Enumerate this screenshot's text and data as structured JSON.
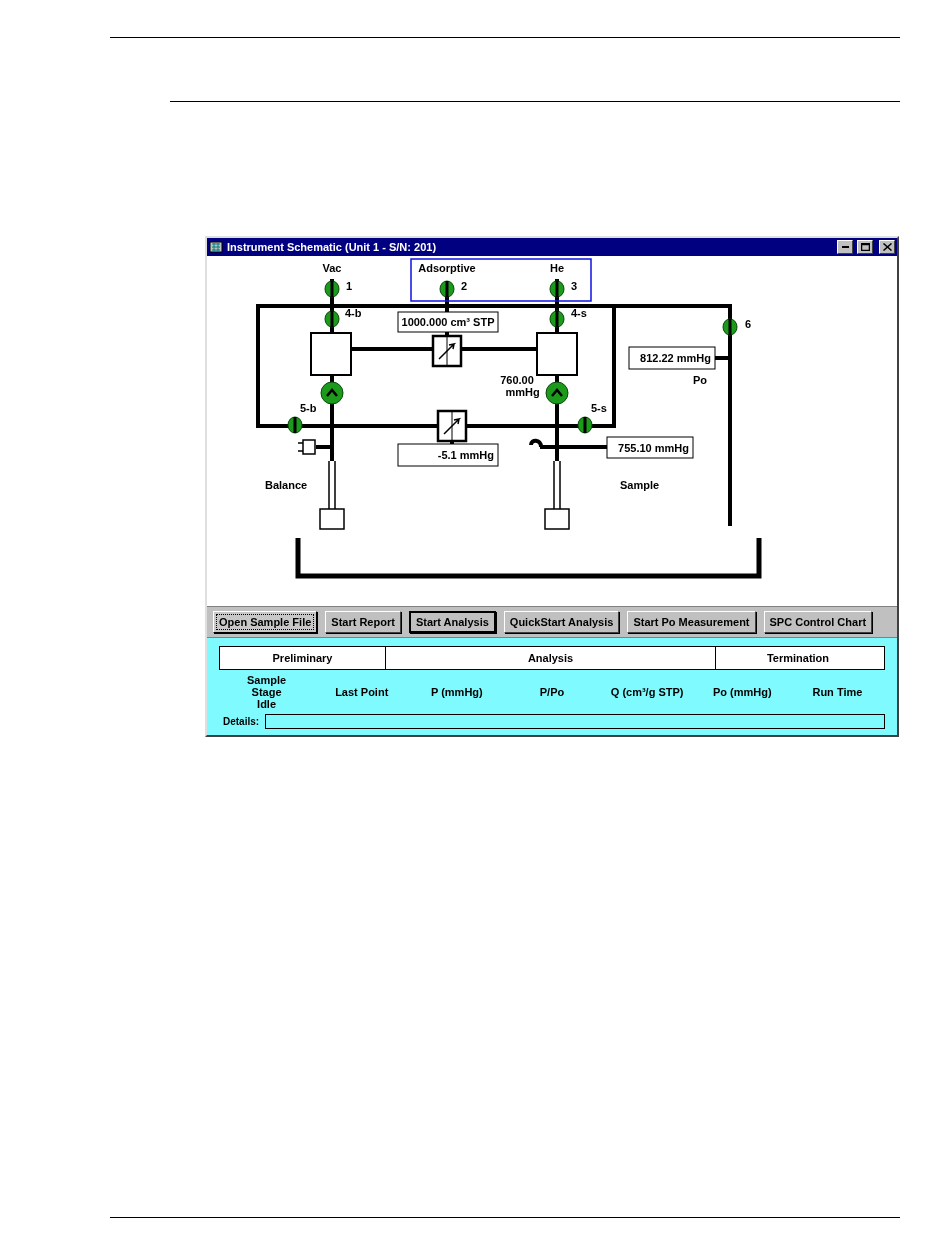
{
  "window": {
    "title": "Instrument Schematic (Unit 1 - S/N: 201)"
  },
  "schematic": {
    "gas_inlets": [
      {
        "label": "Vac",
        "port": "1",
        "open": true,
        "selected": false
      },
      {
        "label": "Adsorptive",
        "port": "2",
        "open": true,
        "selected": true
      },
      {
        "label": "He",
        "port": "3",
        "open": true,
        "selected": true
      }
    ],
    "valves": [
      {
        "label": "4-b",
        "open": true
      },
      {
        "label": "4-s",
        "open": true
      },
      {
        "label": "5-b",
        "open": true
      },
      {
        "label": "5-s",
        "open": true
      },
      {
        "label": "6",
        "open": true
      }
    ],
    "pumps": [
      {
        "open": true
      },
      {
        "open": true
      }
    ],
    "readouts": [
      {
        "kind": "volume",
        "value": "1000.000 cm³ STP"
      },
      {
        "kind": "pressure",
        "value": "-5.1 mmHg"
      },
      {
        "kind": "pressure",
        "value": "755.10 mmHg"
      },
      {
        "kind": "pressure",
        "value": "812.22 mmHg"
      }
    ],
    "labels": [
      {
        "kind": "reading",
        "text": "760.00 mmHg"
      },
      {
        "kind": "name",
        "text": "Po"
      },
      {
        "kind": "name",
        "text": "Balance"
      },
      {
        "kind": "name",
        "text": "Sample"
      }
    ]
  },
  "buttons": [
    {
      "label": "Open Sample File",
      "focused": true,
      "default": false
    },
    {
      "label": "Start Report",
      "focused": false,
      "default": false
    },
    {
      "label": "Start Analysis",
      "focused": false,
      "default": true
    },
    {
      "label": "QuickStart Analysis",
      "focused": false,
      "default": false
    },
    {
      "label": "Start Po Measurement",
      "focused": false,
      "default": false
    },
    {
      "label": "SPC Control Chart",
      "focused": false,
      "default": false
    }
  ],
  "status_panel": {
    "stages": [
      "Preliminary",
      "Analysis",
      "Termination"
    ],
    "columns": [
      {
        "heading": "Sample Stage",
        "value": "Idle"
      },
      {
        "heading": "Last Point"
      },
      {
        "heading": "P (mmHg)"
      },
      {
        "heading": "P/Po"
      },
      {
        "heading": "Q (cm³/g STP)"
      },
      {
        "heading": "Po (mmHg)"
      },
      {
        "heading": "Run Time"
      }
    ],
    "details_label": "Details:"
  }
}
